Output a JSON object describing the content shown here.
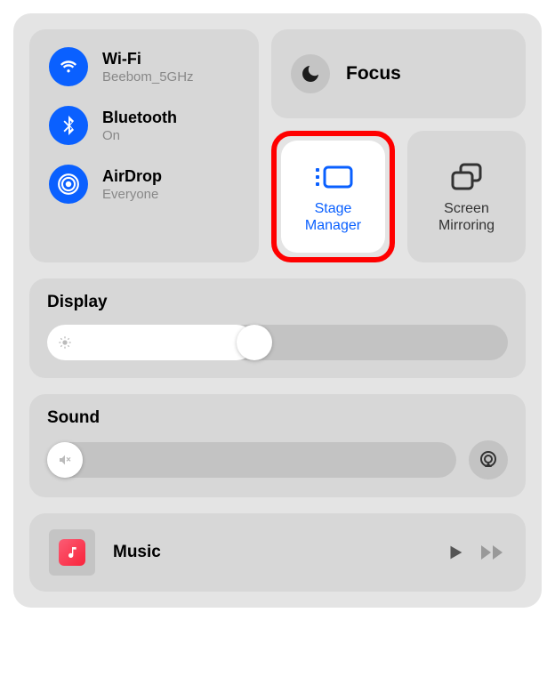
{
  "connectivity": {
    "wifi": {
      "label": "Wi-Fi",
      "status": "Beebom_5GHz"
    },
    "bluetooth": {
      "label": "Bluetooth",
      "status": "On"
    },
    "airdrop": {
      "label": "AirDrop",
      "status": "Everyone"
    }
  },
  "focus": {
    "label": "Focus"
  },
  "tiles": {
    "stage_manager": {
      "label": "Stage\nManager"
    },
    "screen_mirroring": {
      "label": "Screen\nMirroring"
    }
  },
  "display": {
    "title": "Display",
    "value_percent": 45
  },
  "sound": {
    "title": "Sound",
    "value_percent": 0
  },
  "music": {
    "label": "Music"
  },
  "colors": {
    "accent": "#0a60ff",
    "highlight": "#ff0000"
  }
}
